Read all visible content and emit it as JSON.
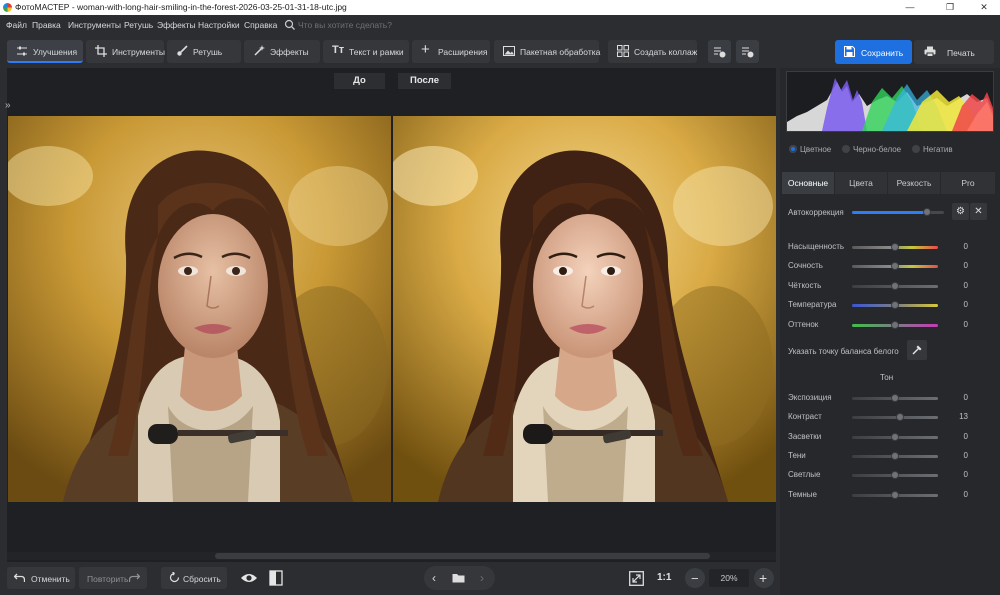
{
  "window": {
    "title": "ФотоМАСТЕР - woman-with-long-hair-smiling-in-the-forest-2026-03-25-01-31-18-utc.jpg",
    "controls": [
      "—",
      "❐",
      "✕"
    ]
  },
  "menu": {
    "items": [
      "Файл",
      "Правка",
      "Инструменты",
      "Ретушь",
      "Эффекты",
      "Настройки",
      "Справка"
    ],
    "search_placeholder": "Что вы хотите сделать?"
  },
  "toolbar": {
    "tabs": [
      "Улучшения",
      "Инструменты",
      "Ретушь",
      "Эффекты",
      "Текст и рамки",
      "Расширения"
    ],
    "batch_label": "Пакетная обработка",
    "collage_label": "Создать коллаж",
    "save_label": "Сохранить",
    "print_label": "Печать"
  },
  "workspace": {
    "before_label": "До",
    "after_label": "После",
    "expand_icon": "»"
  },
  "bottom": {
    "undo_label": "Отменить",
    "redo_label": "Повторить",
    "reset_label": "Сбросить",
    "one_to_one": "1:1",
    "zoom": "20%"
  },
  "panel": {
    "modes": [
      "Цветное",
      "Черно-белое",
      "Негатив"
    ],
    "selected_mode": "Цветное",
    "tabs": [
      "Основные",
      "Цвета",
      "Резкость",
      "Pro"
    ],
    "active_tab": "Основные",
    "autocorrect_label": "Автокоррекция",
    "autocorrect_level": 0.82,
    "white_balance_label": "Указать точку баланса белого",
    "tone_header": "Тон",
    "color_sliders": [
      {
        "label": "Насыщенность",
        "value": "0"
      },
      {
        "label": "Сочность",
        "value": "0"
      },
      {
        "label": "Чёткость",
        "value": "0"
      },
      {
        "label": "Температура",
        "value": "0"
      },
      {
        "label": "Оттенок",
        "value": "0"
      }
    ],
    "tone_sliders": [
      {
        "label": "Экспозиция",
        "value": "0"
      },
      {
        "label": "Контраст",
        "value": "13"
      },
      {
        "label": "Засветки",
        "value": "0"
      },
      {
        "label": "Тени",
        "value": "0"
      },
      {
        "label": "Светлые",
        "value": "0"
      },
      {
        "label": "Темные",
        "value": "0"
      }
    ]
  },
  "colors": {
    "accent": "#1e6fe0",
    "background": "#2b2d30",
    "panel": "#26282b"
  }
}
